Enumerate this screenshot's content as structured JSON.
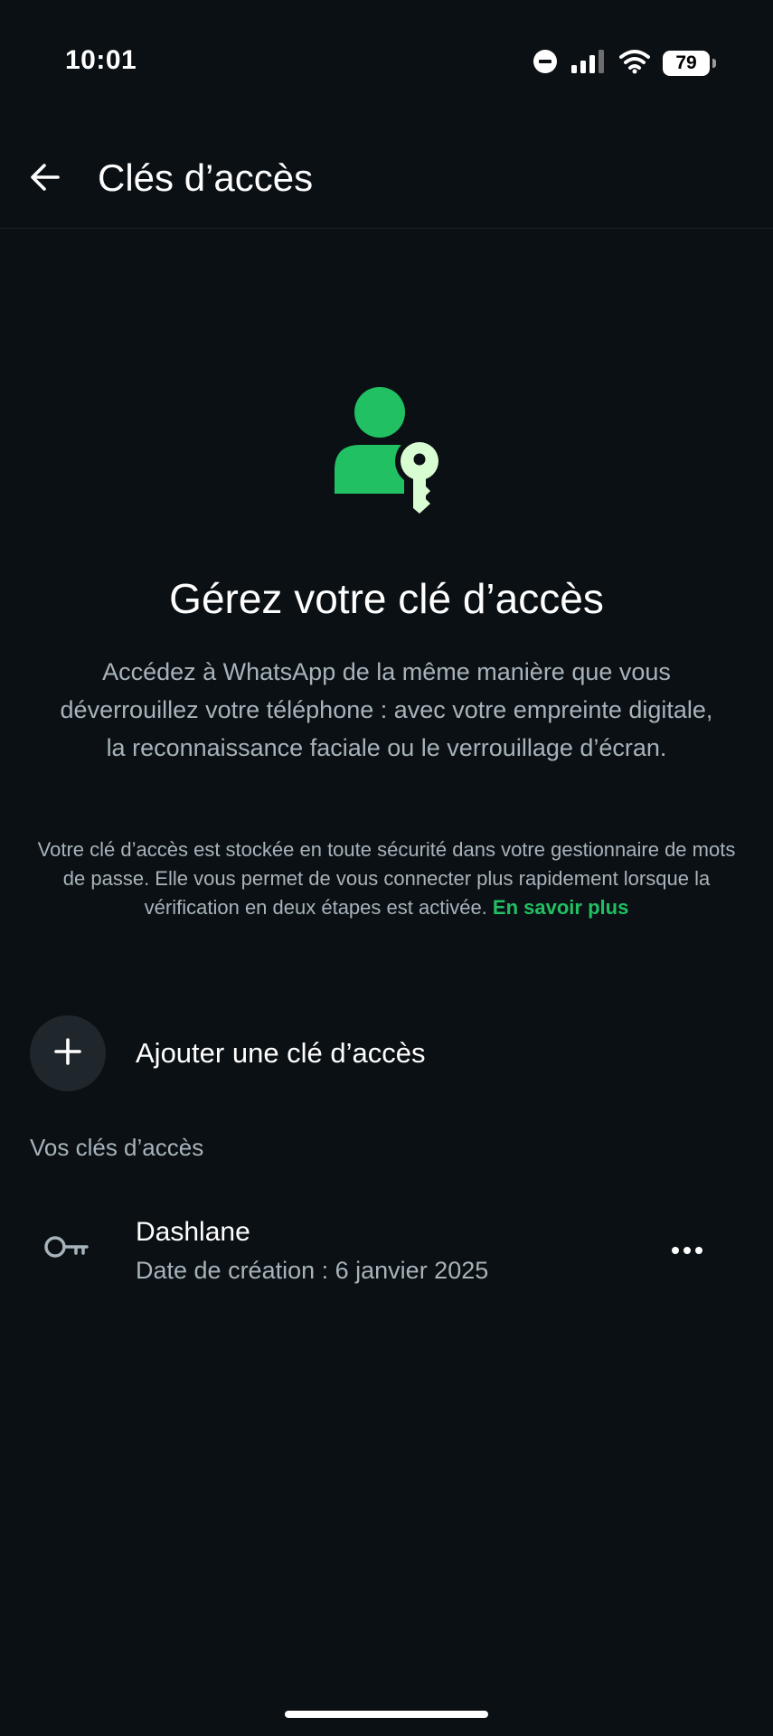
{
  "status_bar": {
    "time": "10:01",
    "battery": "79",
    "icons": [
      "do-not-disturb-icon",
      "cellular-signal-icon",
      "wifi-icon",
      "battery-icon"
    ]
  },
  "app_bar": {
    "title": "Clés d’accès",
    "back_icon": "arrow-left-icon"
  },
  "hero": {
    "icon": "person-key-icon",
    "headline": "Gérez votre clé d’accès",
    "description": "Accédez à WhatsApp de la même manière que vous déverrouillez votre téléphone : avec votre empreinte digitale, la reconnaissance faciale ou le verrouillage d’écran.",
    "note": "Votre clé d’accès est stockée en toute sécurité dans votre gestionnaire de mots de passe. Elle vous permet de vous connecter plus rapidement lorsque la vérification en deux étapes est activée.",
    "learn_more": "En savoir plus"
  },
  "add_passkey": {
    "label": "Ajouter une clé d’accès",
    "icon": "plus-icon"
  },
  "passkeys": {
    "section_title": "Vos clés d’accès",
    "items": [
      {
        "name": "Dashlane",
        "created": "Date de création : 6 janvier 2025",
        "icon": "key-icon",
        "menu_icon": "more-horizontal-icon"
      }
    ]
  },
  "colors": {
    "background": "#0b1014",
    "accent_green": "#21c063",
    "key_light_green": "#d9fdd3",
    "text_primary": "#e9edef",
    "text_secondary": "#a7b3bb",
    "add_circle": "#1f272c"
  }
}
